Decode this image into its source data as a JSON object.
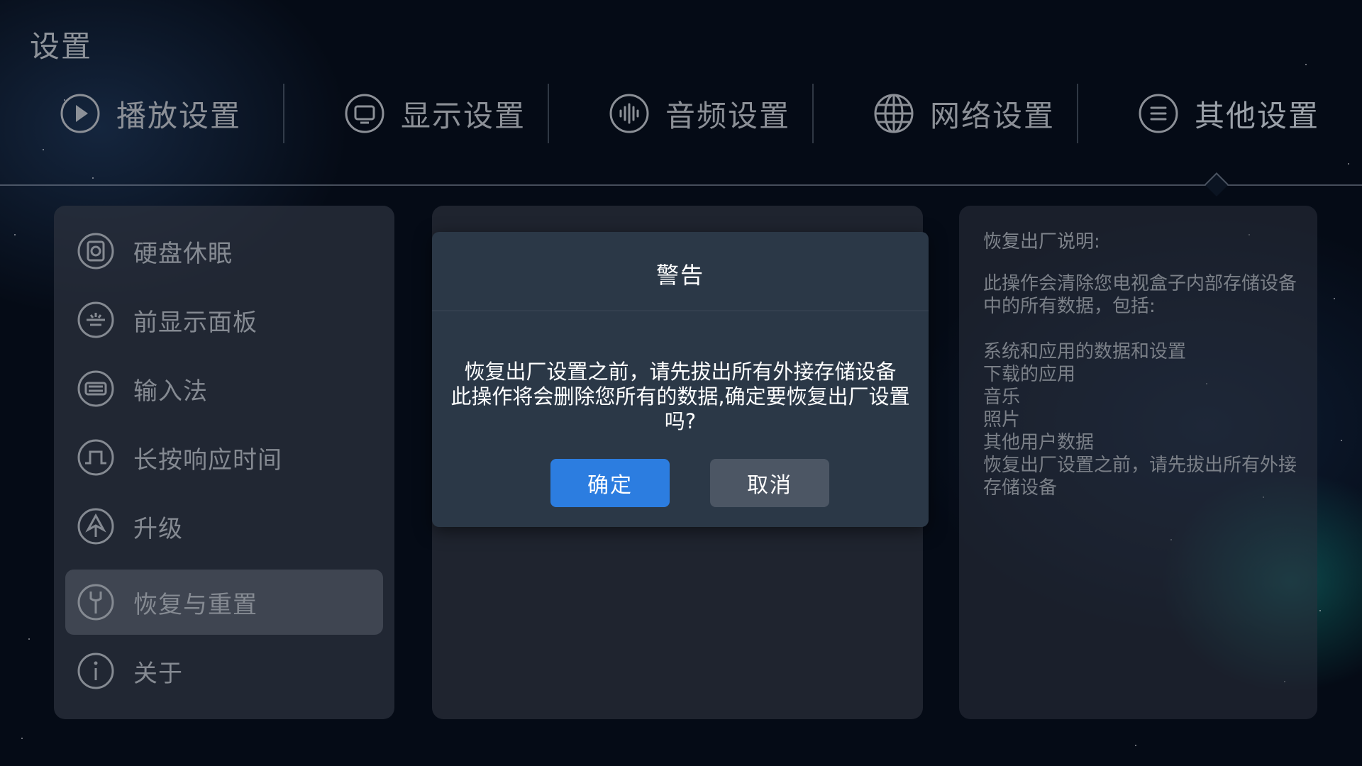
{
  "page": {
    "title": "设置"
  },
  "top_tabs": [
    {
      "label": "播放设置",
      "icon": "play-icon"
    },
    {
      "label": "显示设置",
      "icon": "monitor-icon"
    },
    {
      "label": "音频设置",
      "icon": "audio-icon"
    },
    {
      "label": "网络设置",
      "icon": "globe-icon"
    },
    {
      "label": "其他设置",
      "icon": "menu-icon",
      "active": true
    }
  ],
  "sidebar": {
    "items": [
      {
        "label": "硬盘休眠",
        "icon": "disk-icon"
      },
      {
        "label": "前显示面板",
        "icon": "front-panel-icon"
      },
      {
        "label": "输入法",
        "icon": "keyboard-icon"
      },
      {
        "label": "长按响应时间",
        "icon": "pulse-icon"
      },
      {
        "label": "升级",
        "icon": "upgrade-icon"
      },
      {
        "label": "恢复与重置",
        "icon": "wrench-icon",
        "selected": true
      },
      {
        "label": "关于",
        "icon": "info-icon"
      }
    ]
  },
  "info": {
    "title": "恢复出厂说明:",
    "desc": "此操作会清除您电视盒子内部存储设备中的所有数据，包括:",
    "list": [
      "系统和应用的数据和设置",
      "下载的应用",
      "音乐",
      "照片",
      "其他用户数据",
      "恢复出厂设置之前，请先拔出所有外接存储设备"
    ]
  },
  "dialog": {
    "title": "警告",
    "message_line1": "恢复出厂设置之前，请先拔出所有外接存储设备",
    "message_line2": "此操作将会删除您所有的数据,确定要恢复出厂设置吗?",
    "ok_label": "确定",
    "cancel_label": "取消"
  },
  "colors": {
    "background": "#050b16",
    "accent": "#2c7de0",
    "dialog": "#2b3847",
    "cancel": "#4c5664"
  }
}
